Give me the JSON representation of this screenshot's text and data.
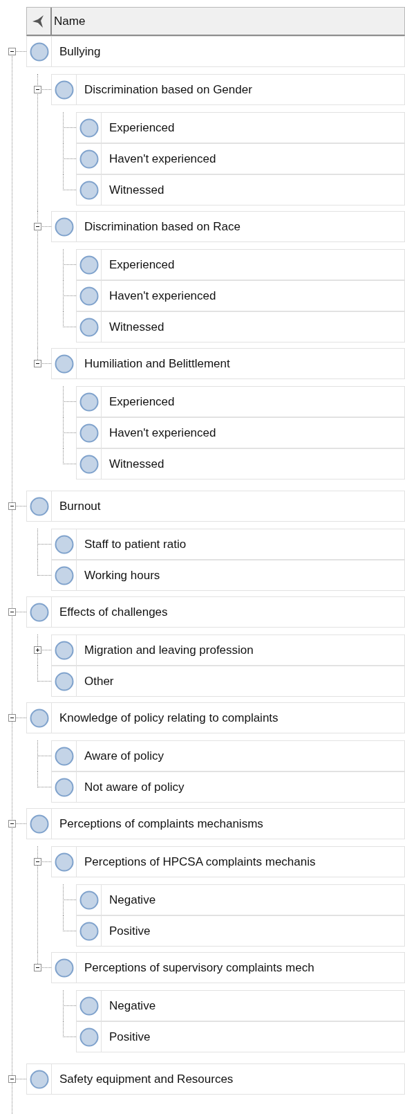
{
  "header": {
    "column": "Name"
  },
  "nodes": [
    {
      "label": "Bullying",
      "expanded": true,
      "children": [
        {
          "label": "Discrimination based on Gender",
          "expanded": true,
          "children": [
            {
              "label": "Experienced"
            },
            {
              "label": "Haven't experienced"
            },
            {
              "label": "Witnessed"
            }
          ]
        },
        {
          "label": "Discrimination based on Race",
          "expanded": true,
          "children": [
            {
              "label": "Experienced"
            },
            {
              "label": "Haven't experienced"
            },
            {
              "label": "Witnessed"
            }
          ]
        },
        {
          "label": "Humiliation and Belittlement",
          "expanded": true,
          "children": [
            {
              "label": "Experienced"
            },
            {
              "label": "Haven't experienced"
            },
            {
              "label": "Witnessed"
            }
          ]
        }
      ]
    },
    {
      "label": "Burnout",
      "expanded": true,
      "children": [
        {
          "label": "Staff to patient ratio"
        },
        {
          "label": "Working hours"
        }
      ]
    },
    {
      "label": "Effects of challenges",
      "expanded": true,
      "children": [
        {
          "label": "Migration and leaving profession",
          "expanded": false
        },
        {
          "label": "Other"
        }
      ]
    },
    {
      "label": "Knowledge of policy relating to complaints",
      "expanded": true,
      "children": [
        {
          "label": "Aware of policy"
        },
        {
          "label": "Not aware of policy"
        }
      ]
    },
    {
      "label": "Perceptions of complaints mechanisms",
      "expanded": true,
      "children": [
        {
          "label": "Perceptions of HPCSA complaints mechanis",
          "expanded": true,
          "children": [
            {
              "label": "Negative"
            },
            {
              "label": "Positive"
            }
          ]
        },
        {
          "label": "Perceptions of supervisory complaints mech",
          "expanded": true,
          "children": [
            {
              "label": "Negative"
            },
            {
              "label": "Positive"
            }
          ]
        }
      ]
    },
    {
      "label": "Safety equipment and Resources",
      "expanded": true
    }
  ]
}
